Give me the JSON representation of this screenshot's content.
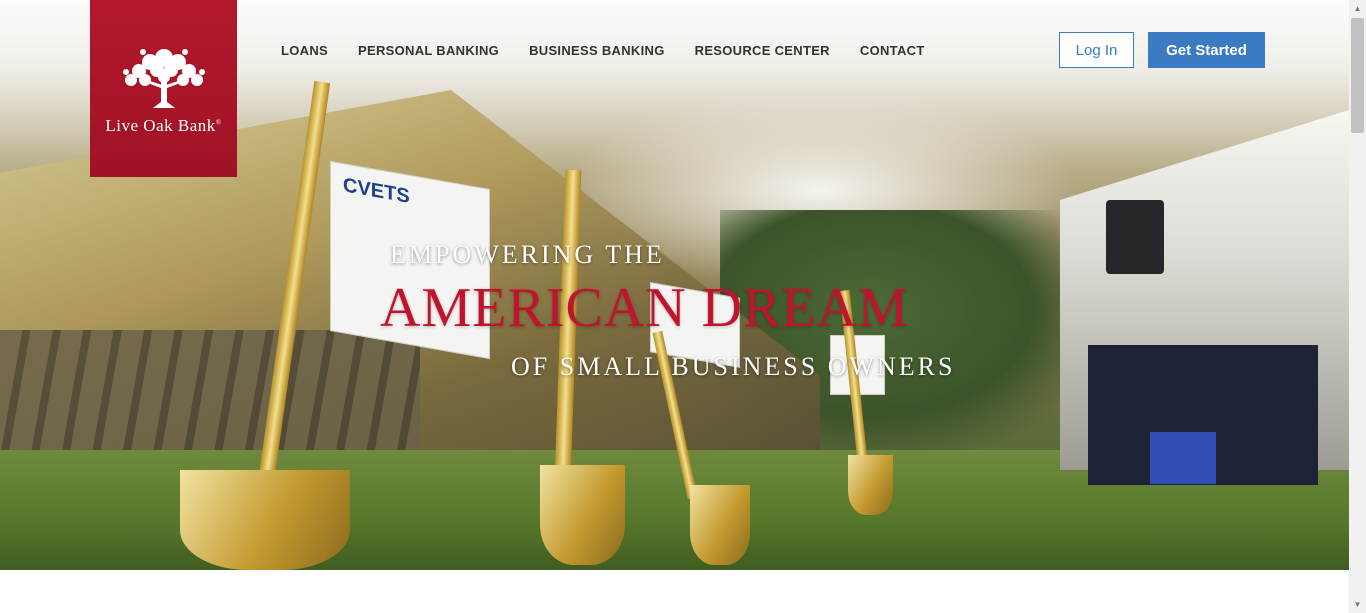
{
  "brand": {
    "name": "Live Oak Bank",
    "mark": "®",
    "color": "#b3182c"
  },
  "nav": {
    "items": [
      {
        "label": "LOANS"
      },
      {
        "label": "PERSONAL BANKING"
      },
      {
        "label": "BUSINESS BANKING"
      },
      {
        "label": "RESOURCE CENTER"
      },
      {
        "label": "CONTACT"
      }
    ]
  },
  "actions": {
    "login_label": "Log In",
    "get_started_label": "Get Started",
    "accent": "#3a7bc4"
  },
  "hero": {
    "line1": "EMPOWERING THE",
    "line2": "AMERICAN DREAM",
    "line3": "OF SMALL BUSINESS OWNERS",
    "sign_text": "CVETS",
    "highlight_color": "#c0142d"
  },
  "icons": {
    "brand_logo": "oak-tree-icon",
    "scroll_up": "triangle-up-icon",
    "scroll_down": "triangle-down-icon"
  }
}
